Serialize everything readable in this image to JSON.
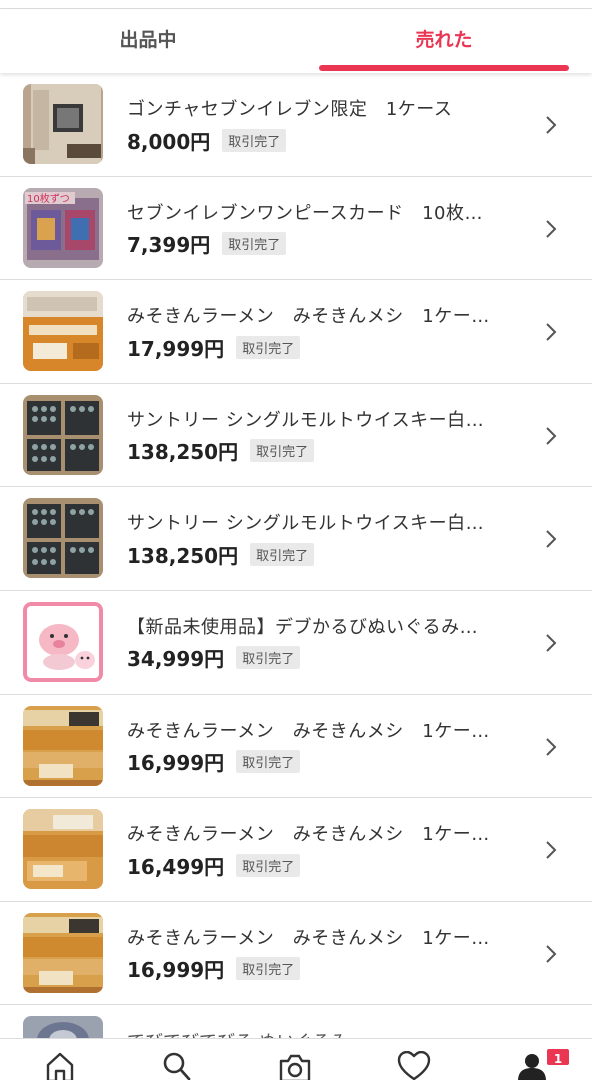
{
  "tabs": [
    {
      "label": "出品中"
    },
    {
      "label": "売れた"
    }
  ],
  "colors": {
    "accent": "#ea3553"
  },
  "items": [
    {
      "title": "ゴンチャセブンイレブン限定　1ケース",
      "price": "8,000円",
      "status": "取引完了"
    },
    {
      "title": "セブンイレブンワンピースカード　10枚…",
      "price": "7,399円",
      "status": "取引完了"
    },
    {
      "title": "みそきんラーメン　みそきんメシ　1ケー…",
      "price": "17,999円",
      "status": "取引完了"
    },
    {
      "title": "サントリー シングルモルトウイスキー白…",
      "price": "138,250円",
      "status": "取引完了"
    },
    {
      "title": "サントリー シングルモルトウイスキー白…",
      "price": "138,250円",
      "status": "取引完了"
    },
    {
      "title": "【新品未使用品】デブかるびぬいぐるみ…",
      "price": "34,999円",
      "status": "取引完了"
    },
    {
      "title": "みそきんラーメン　みそきんメシ　1ケー…",
      "price": "16,999円",
      "status": "取引完了"
    },
    {
      "title": "みそきんラーメン　みそきんメシ　1ケー…",
      "price": "16,499円",
      "status": "取引完了"
    },
    {
      "title": "みそきんラーメン　みそきんメシ　1ケー…",
      "price": "16,999円",
      "status": "取引完了"
    }
  ],
  "partial_item": {
    "title": "でびでびでびる ぬいぐるみ"
  },
  "bottom_nav": {
    "icons": [
      "home-icon",
      "search-icon",
      "camera-icon",
      "heart-icon",
      "user-icon"
    ],
    "notification_count": "1"
  }
}
